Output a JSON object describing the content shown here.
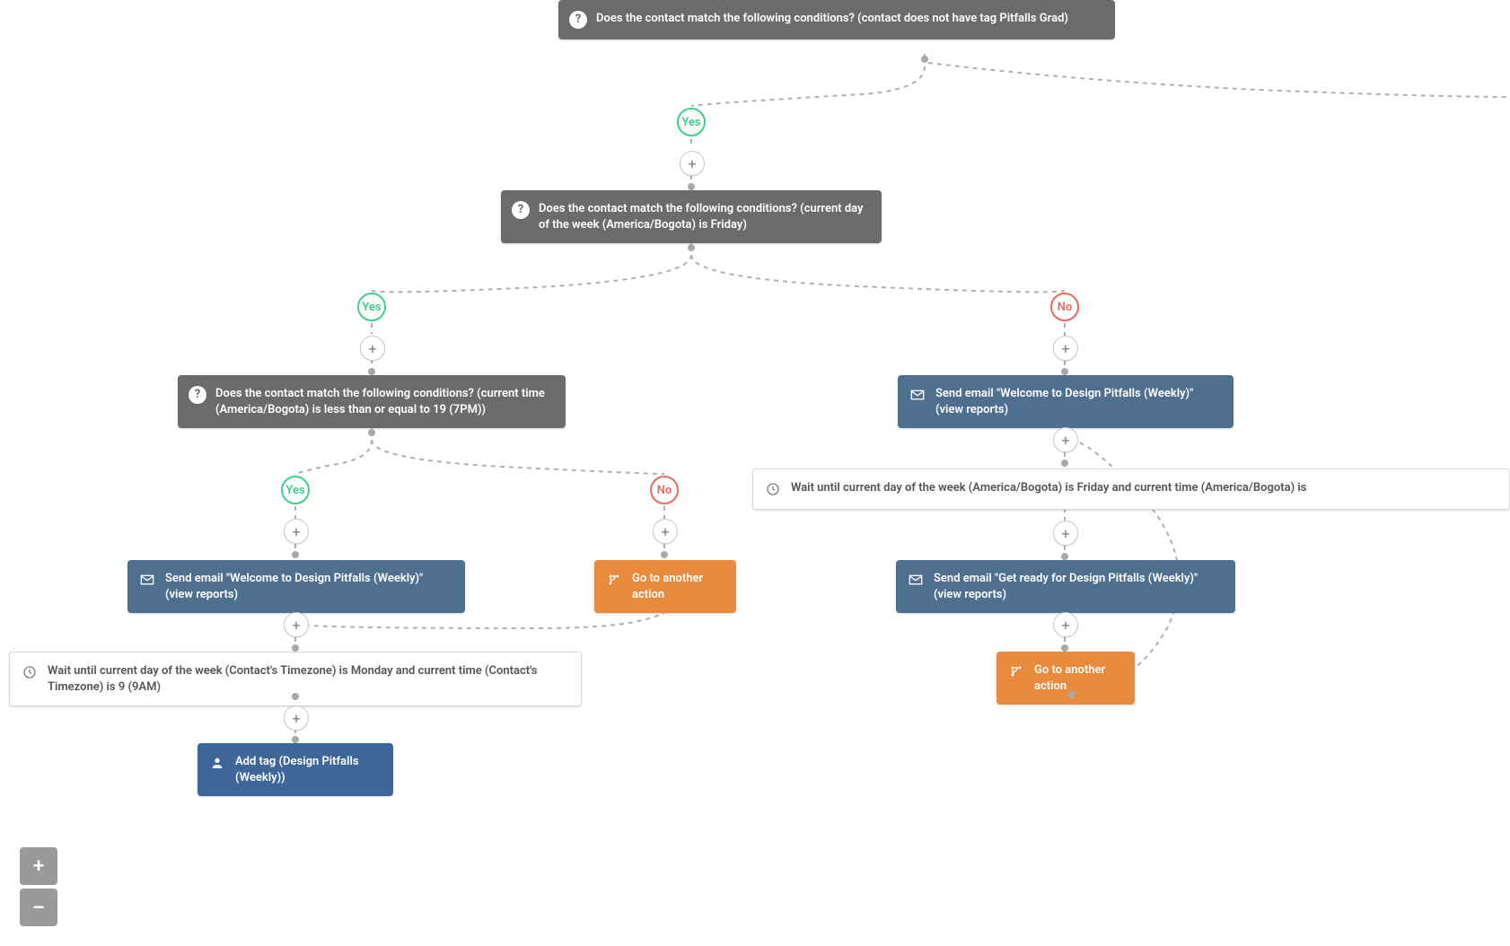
{
  "labels": {
    "yes": "Yes",
    "no": "No",
    "plus": "+"
  },
  "zoom": {
    "in": "+",
    "out": "−"
  },
  "nodes": {
    "cond_top": "Does the contact match the following conditions? (contact does not have tag Pitfalls Grad)",
    "cond_friday": "Does the contact match the following conditions? (current day of the week (America/Bogota) is Friday)",
    "cond_time": "Does the contact match the following conditions? (current time (America/Bogota) is less than or equal to 19 (7PM))",
    "email_welcome": "Send email \"Welcome to Design Pitfalls (Weekly)\" (view reports)",
    "wait_monday": "Wait until current day of the week (Contact's Timezone) is Monday and current time (Contact's Timezone) is 9 (9AM)",
    "addtag": "Add tag (Design Pitfalls (Weekly))",
    "goto": "Go to another action",
    "email_welcome_r": "Send email \"Welcome to Design Pitfalls (Weekly)\" (view reports)",
    "wait_friday": "Wait until current day of the week (America/Bogota) is Friday and current time (America/Bogota) is",
    "email_ready": "Send email \"Get ready for Design Pitfalls (Weekly)\" (view reports)",
    "goto_r": "Go to another action"
  }
}
